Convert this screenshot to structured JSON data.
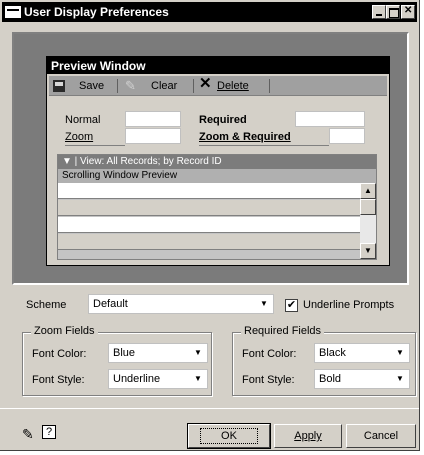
{
  "window": {
    "title": "User Display Preferences"
  },
  "preview": {
    "title": "Preview Window",
    "toolbar": {
      "save": "Save",
      "clear": "Clear",
      "delete": "Delete"
    },
    "fields": {
      "normal": "Normal",
      "zoom": "Zoom",
      "required": "Required",
      "zoom_required": "Zoom & Required"
    },
    "scroll": {
      "view_label": "▼ | View: All Records; by Record ID",
      "header": "Scrolling Window Preview"
    }
  },
  "scheme": {
    "label": "Scheme",
    "value": "Default"
  },
  "underline_prompts": {
    "label": "Underline Prompts",
    "checked": true
  },
  "zoom_fields": {
    "title": "Zoom Fields",
    "font_color_label": "Font Color:",
    "font_color": "Blue",
    "font_style_label": "Font Style:",
    "font_style": "Underline"
  },
  "required_fields": {
    "title": "Required Fields",
    "font_color_label": "Font Color:",
    "font_color": "Black",
    "font_style_label": "Font Style:",
    "font_style": "Bold"
  },
  "buttons": {
    "ok": "OK",
    "apply": "Apply",
    "cancel": "Cancel"
  },
  "icons": {
    "help": "?"
  }
}
